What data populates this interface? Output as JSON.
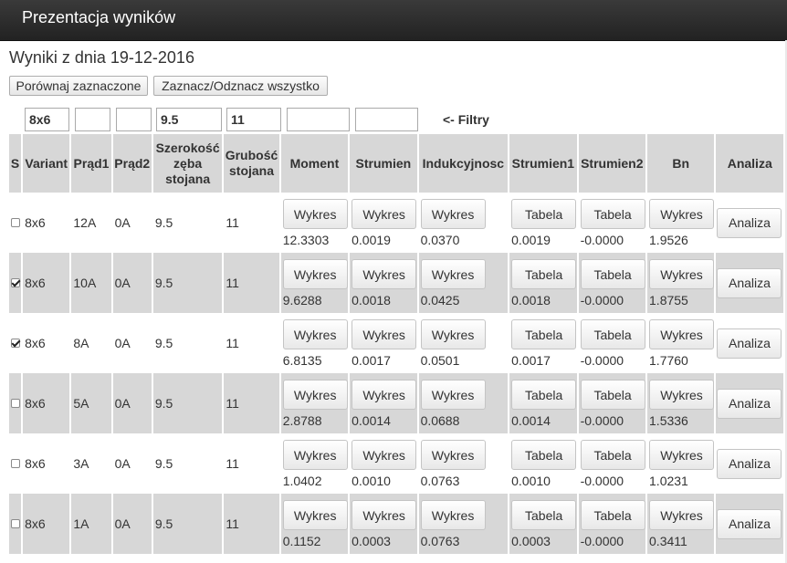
{
  "header": {
    "title": "Prezentacja wyników"
  },
  "results_date": "Wyniki z dnia 19-12-2016",
  "toolbar": {
    "compare_label": "Porównaj zaznaczone",
    "toggle_all_label": "Zaznacz/Odznacz wszystko"
  },
  "filters": {
    "variant": "8x6",
    "prad1": "",
    "prad2": "",
    "szerokosc": "9.5",
    "grubosc": "11",
    "moment": "",
    "strumien": "",
    "label": "<- Filtry"
  },
  "columns": {
    "s": "S",
    "variant": "Variant",
    "prad1": "Prąd1",
    "prad2": "Prąd2",
    "szerokosc_1": "Szerokość",
    "szerokosc_2": "zęba",
    "szerokosc_3": "stojana",
    "grubosc_1": "Grubość",
    "grubosc_2": "stojana",
    "moment": "Moment",
    "strumien": "Strumien",
    "indukcyjnosc": "Indukcyjnosc",
    "strumien1": "Strumien1",
    "strumien2": "Strumien2",
    "bn": "Bn",
    "analiza": "Analiza"
  },
  "labels": {
    "wykres": "Wykres",
    "tabela": "Tabela",
    "analiza": "Analiza"
  },
  "rows": [
    {
      "checked": false,
      "variant": "8x6",
      "prad1": "12A",
      "prad2": "0A",
      "szerokosc": "9.5",
      "grubosc": "11",
      "moment": "12.3303",
      "strumien": "0.0019",
      "indukcyjnosc": "0.0370",
      "strumien1": "0.0019",
      "strumien2": "-0.0000",
      "bn": "1.9526"
    },
    {
      "checked": true,
      "variant": "8x6",
      "prad1": "10A",
      "prad2": "0A",
      "szerokosc": "9.5",
      "grubosc": "11",
      "moment": "9.6288",
      "strumien": "0.0018",
      "indukcyjnosc": "0.0425",
      "strumien1": "0.0018",
      "strumien2": "-0.0000",
      "bn": "1.8755"
    },
    {
      "checked": true,
      "variant": "8x6",
      "prad1": "8A",
      "prad2": "0A",
      "szerokosc": "9.5",
      "grubosc": "11",
      "moment": "6.8135",
      "strumien": "0.0017",
      "indukcyjnosc": "0.0501",
      "strumien1": "0.0017",
      "strumien2": "-0.0000",
      "bn": "1.7760"
    },
    {
      "checked": false,
      "variant": "8x6",
      "prad1": "5A",
      "prad2": "0A",
      "szerokosc": "9.5",
      "grubosc": "11",
      "moment": "2.8788",
      "strumien": "0.0014",
      "indukcyjnosc": "0.0688",
      "strumien1": "0.0014",
      "strumien2": "-0.0000",
      "bn": "1.5336"
    },
    {
      "checked": false,
      "variant": "8x6",
      "prad1": "3A",
      "prad2": "0A",
      "szerokosc": "9.5",
      "grubosc": "11",
      "moment": "1.0402",
      "strumien": "0.0010",
      "indukcyjnosc": "0.0763",
      "strumien1": "0.0010",
      "strumien2": "-0.0000",
      "bn": "1.0231"
    },
    {
      "checked": false,
      "variant": "8x6",
      "prad1": "1A",
      "prad2": "0A",
      "szerokosc": "9.5",
      "grubosc": "11",
      "moment": "0.1152",
      "strumien": "0.0003",
      "indukcyjnosc": "0.0763",
      "strumien1": "0.0003",
      "strumien2": "-0.0000",
      "bn": "0.3411"
    }
  ]
}
